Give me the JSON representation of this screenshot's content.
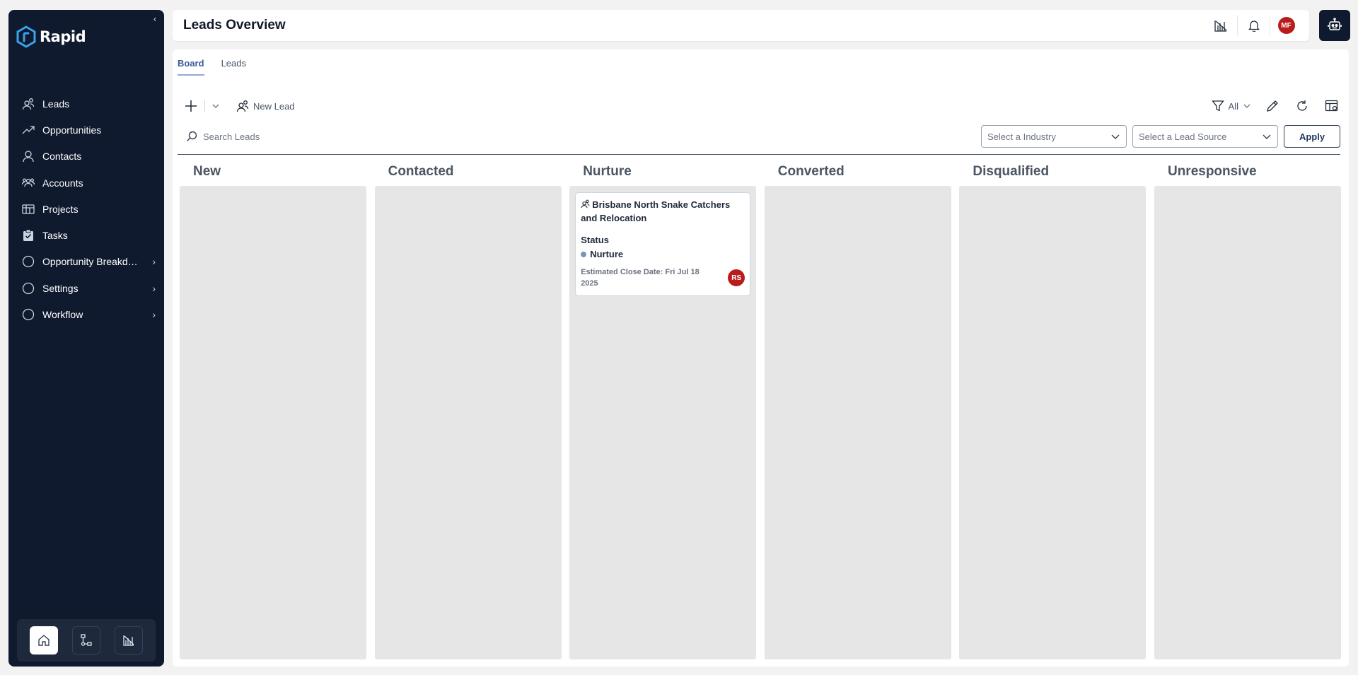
{
  "app": {
    "name": "Rapid"
  },
  "sidebar": {
    "items": [
      {
        "label": "Leads",
        "icon": "leads-icon"
      },
      {
        "label": "Opportunities",
        "icon": "trend-icon"
      },
      {
        "label": "Contacts",
        "icon": "user-icon"
      },
      {
        "label": "Accounts",
        "icon": "accounts-icon"
      },
      {
        "label": "Projects",
        "icon": "projects-icon"
      },
      {
        "label": "Tasks",
        "icon": "tasks-icon"
      },
      {
        "label": "Opportunity Breakdown",
        "icon": "circle-icon",
        "has_children": true
      },
      {
        "label": "Settings",
        "icon": "circle-icon",
        "has_children": true
      },
      {
        "label": "Workflow",
        "icon": "circle-icon",
        "has_children": true
      }
    ],
    "dock": [
      "home-icon",
      "flow-icon",
      "report-icon"
    ]
  },
  "header": {
    "title": "Leads Overview",
    "user_initials": "MF"
  },
  "tabs": [
    {
      "label": "Board",
      "active": true
    },
    {
      "label": "Leads",
      "active": false
    }
  ],
  "toolbar": {
    "new_lead_label": "New Lead",
    "filter_label": "All"
  },
  "search": {
    "placeholder": "Search Leads",
    "industry_placeholder": "Select a Industry",
    "lead_source_placeholder": "Select a Lead Source",
    "apply_label": "Apply"
  },
  "board": {
    "columns": [
      {
        "title": "New",
        "cards": []
      },
      {
        "title": "Contacted",
        "cards": []
      },
      {
        "title": "Nurture",
        "cards": [
          {
            "title": "Brisbane North Snake Catchers and Relocation",
            "status_label": "Status",
            "status": "Nurture",
            "close_date": "Estimated Close Date: Fri Jul 18 2025",
            "owner_initials": "RS"
          }
        ]
      },
      {
        "title": "Converted",
        "cards": []
      },
      {
        "title": "Disqualified",
        "cards": []
      },
      {
        "title": "Unresponsive",
        "cards": []
      }
    ]
  },
  "colors": {
    "sidebar_bg": "#0f1a2e",
    "avatar_red": "#b91c1c",
    "column_bg": "#e6e6e6",
    "tab_active": "#3b5b9a"
  }
}
